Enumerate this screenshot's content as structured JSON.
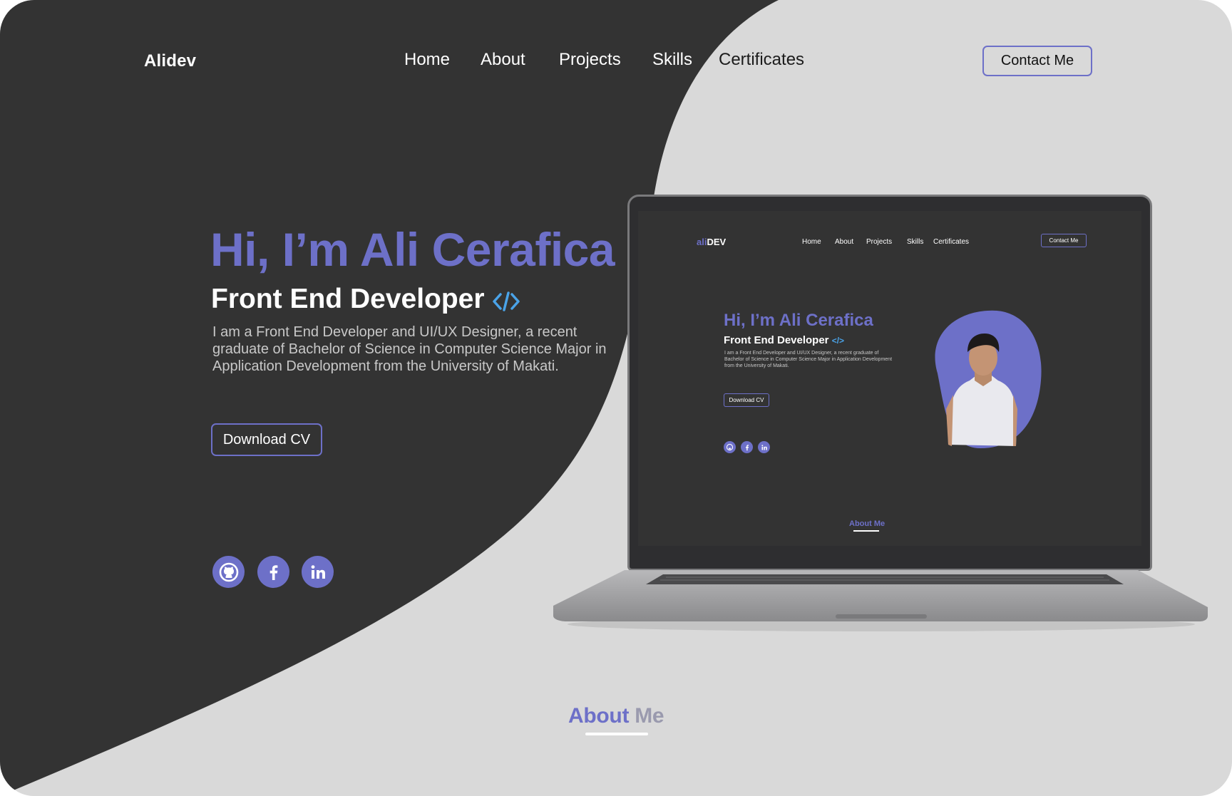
{
  "brand": "Alidev",
  "nav": {
    "items": [
      {
        "label": "Home"
      },
      {
        "label": "About"
      },
      {
        "label": "Projects"
      },
      {
        "label": "Skills"
      },
      {
        "label": "Certificates"
      }
    ],
    "contact_label": "Contact Me"
  },
  "hero": {
    "greeting": "Hi, I’m Ali Cerafica",
    "role": "Front End Developer",
    "description": "I am a Front End Developer and UI/UX Designer, a recent graduate of Bachelor of Science in Computer Science Major in Application Development from the University of Makati.",
    "cv_label": "Download CV",
    "code_icon": "code-brackets-icon"
  },
  "social": [
    {
      "icon": "github-icon"
    },
    {
      "icon": "facebook-icon"
    },
    {
      "icon": "linkedin-icon"
    }
  ],
  "about": {
    "part1": "About",
    "part2": "Me"
  },
  "mockup": {
    "brand_accent": "ali",
    "brand_rest": "DEV",
    "nav": [
      "Home",
      "About",
      "Projects",
      "Skills",
      "Certificates"
    ],
    "contact_label": "Contact Me",
    "greeting": "Hi, I’m Ali Cerafica",
    "role": "Front End Developer",
    "description": "I am a Front End Developer and UI/UX Designer, a recent graduate of Bachelor of Science in Computer Science Major in Application Development from the University of Makati.",
    "cv_label": "Download CV",
    "about_label": "About Me"
  },
  "colors": {
    "accent": "#6d70c8",
    "dark_bg": "#333333",
    "light_bg": "#d9d9d9"
  }
}
